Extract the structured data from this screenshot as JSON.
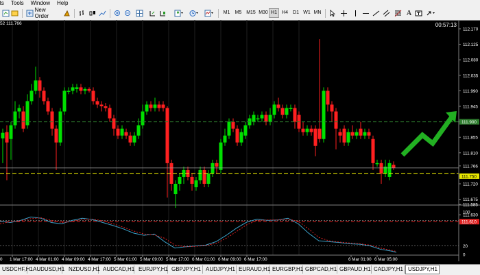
{
  "menu": [
    "rts",
    "Tools",
    "Window",
    "Help"
  ],
  "toolbar": {
    "new_order_label": "New Order",
    "timeframes": [
      "M1",
      "M5",
      "M15",
      "M30",
      "H1",
      "H4",
      "D1",
      "W1",
      "MN"
    ],
    "active_timeframe": "H1"
  },
  "chart": {
    "header": "52 111.766",
    "countdown": "00:57:13",
    "price_ticks": [
      "112.170",
      "112.125",
      "112.080",
      "112.035",
      "111.990",
      "111.945",
      "111.900",
      "111.855",
      "111.810",
      "111.766",
      "111.750",
      "111.720",
      "111.675",
      "111.630",
      "111.585"
    ],
    "green_line_label": "111.900",
    "yellow_line_label": "111.750",
    "red_line_label": "111.610",
    "current_price_label": "111.766",
    "osc_ticks": [
      "100",
      "80",
      "20",
      "0"
    ],
    "time_labels": [
      "1 Mar 17:00",
      "4 Mar 01:00",
      "4 Mar 09:00",
      "4 Mar 17:00",
      "5 Mar 01:00",
      "5 Mar 09:00",
      "5 Mar 17:00",
      "6 Mar 01:00",
      "6 Mar 09:00",
      "6 Mar 17:00",
      "6 Mar 01:00",
      "6 Mar 05:00"
    ],
    "time_label_first": "0"
  },
  "tabs": [
    "USDCHF,H1",
    "AUDUSD,H1",
    "NZDUSD,H1",
    "AUDCAD,H1",
    "EURJPY,H1",
    "GBPJPY,H1",
    "AUDJPY,H1",
    "EURAUD,H1",
    "EURGBP,H1",
    "GBPCAD,H1",
    "GBPAUD,H1",
    "CADJPY,H1",
    "USDJPY,H1"
  ],
  "active_tab": "USDJPY,H1",
  "colors": {
    "bull": "#00e000",
    "bear": "#ff2020",
    "arrow": "#22b022",
    "green_line": "#2e7d2e",
    "yellow_line": "#e6e600",
    "red_line": "#e02020"
  }
}
